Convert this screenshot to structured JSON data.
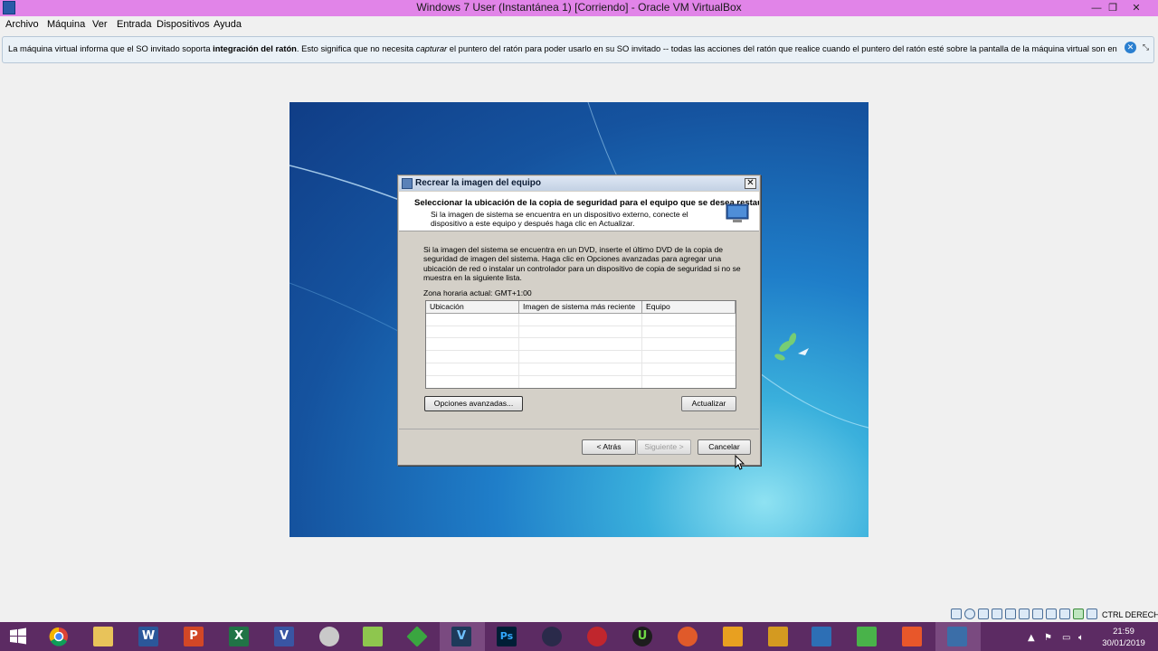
{
  "window": {
    "title": "Windows 7 User (Instantánea 1) [Corriendo] - Oracle VM VirtualBox",
    "minimize": "—",
    "maximize": "❐",
    "close": "✕"
  },
  "menu": {
    "items": [
      "Archivo",
      "Máquina",
      "Ver",
      "Entrada",
      "Dispositivos",
      "Ayuda"
    ]
  },
  "infobar": {
    "text_1": "La máquina virtual informa que el SO invitado soporta ",
    "bold": "integración del ratón",
    "text_2": ". Esto significa que no necesita ",
    "italic": "capturar",
    "text_3": " el puntero del ratón para poder usarlo en su SO invitado -- todas las acciones del ratón que realice cuando el puntero del ratón esté sobre la pantalla de la máquina virtual son enviadas directamente al"
  },
  "dialog": {
    "title": "Recrear la imagen del equipo",
    "header_title": "Seleccionar la ubicación de la copia de seguridad para el equipo que se desea restaurar",
    "header_desc": "Si la imagen de sistema se encuentra en un dispositivo externo, conecte el dispositivo a este equipo y después haga clic en Actualizar.",
    "body": "Si la imagen del sistema se encuentra en un DVD, inserte el último DVD de la copia de seguridad de imagen del sistema. Haga clic en Opciones avanzadas para agregar una ubicación de red o instalar un controlador para un dispositivo de copia de seguridad si no se muestra en la siguiente lista.",
    "timezone": "Zona horaria actual: GMT+1:00",
    "columns": [
      "Ubicación",
      "Imagen de sistema más reciente",
      "Equipo"
    ],
    "rows": [],
    "btn_advanced": "Opciones avanzadas...",
    "btn_refresh": "Actualizar",
    "btn_back": "< Atrás",
    "btn_next": "Siguiente >",
    "btn_cancel": "Cancelar"
  },
  "statusbar": {
    "host_key": "CTRL DERECHA"
  },
  "taskbar": {
    "apps": [
      "start-button",
      "chrome-icon",
      "file-explorer-icon",
      "word-icon",
      "powerpoint-icon",
      "excel-icon",
      "visio-icon",
      "app-icon",
      "sims-icon",
      "sims-diamond-icon",
      "visual-studio-icon",
      "photoshop-icon",
      "app-icon",
      "app-icon",
      "upwork-icon",
      "app-icon",
      "app-icon",
      "app-icon",
      "virtualbox-icon",
      "camtasia-icon",
      "camtasia-recorder-icon",
      "windows7-vm-icon"
    ],
    "glyphs": [
      "W",
      "P",
      "X",
      "V",
      "V",
      "Ps",
      "U"
    ],
    "time": "21:59",
    "date": "30/01/2019"
  },
  "colors": {
    "titlebar": "#e184e8",
    "taskbar": "#5c2b63",
    "desktop_blue": "#15539f"
  }
}
